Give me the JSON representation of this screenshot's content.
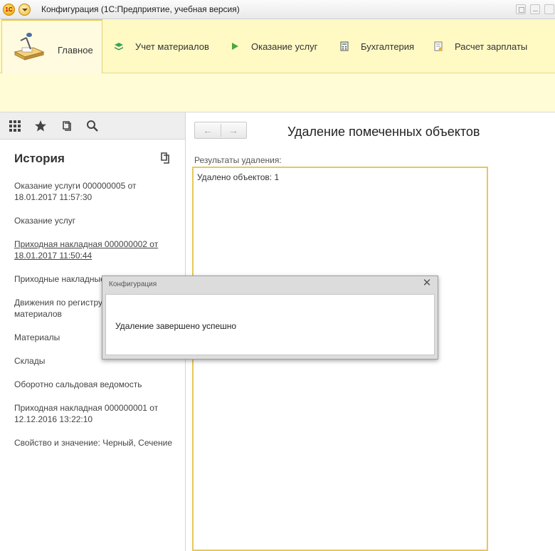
{
  "window": {
    "logo_text": "1С",
    "title": "Конфигурация  (1С:Предприятие, учебная версия)"
  },
  "sections": [
    {
      "label": "Главное",
      "icon": "desk-lamp-icon",
      "active": true
    },
    {
      "label": "Учет материалов",
      "icon": "layers-icon",
      "active": false
    },
    {
      "label": "Оказание услуг",
      "icon": "play-icon",
      "active": false
    },
    {
      "label": "Бухгалтерия",
      "icon": "calculator-icon",
      "active": false
    },
    {
      "label": "Расчет зарплаты",
      "icon": "payroll-icon",
      "active": false
    }
  ],
  "left_panel": {
    "toolbar_icons": [
      "apps-grid-icon",
      "star-icon",
      "history-icon",
      "search-icon"
    ],
    "history_title": "История",
    "history_items": [
      "Оказание услуги 000000005 от 18.01.2017 11:57:30",
      "Оказание услуг",
      "Приходная накладная 000000002 от 18.01.2017 11:50:44",
      "Приходные накладные",
      "Движения по регистру Остатки материалов",
      "Материалы",
      "Склады",
      "Оборотно сальдовая ведомость",
      "Приходная накладная 000000001 от 12.12.2016 13:22:10",
      "Свойство и значение: Черный, Сечение"
    ]
  },
  "main": {
    "title": "Удаление помеченных объектов",
    "result_label": "Результаты удаления:",
    "result_text": "Удалено объектов: 1",
    "colors": {
      "accent_border": "#e6c85a",
      "section_bg": "#fff9c4"
    }
  },
  "dialog": {
    "title": "Конфигурация",
    "message": "Удаление завершено успешно"
  }
}
